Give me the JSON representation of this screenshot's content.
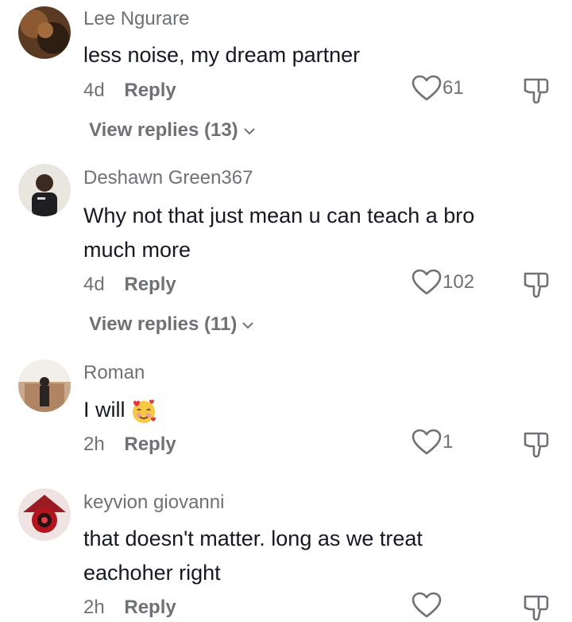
{
  "comments": [
    {
      "username": "Lee Ngurare",
      "text": "less noise, my dream partner",
      "time": "4d",
      "reply": "Reply",
      "likes": "61",
      "view_replies": "View replies (13)"
    },
    {
      "username": "Deshawn Green367",
      "text": "Why not that just mean u can teach a bro much more",
      "time": "4d",
      "reply": "Reply",
      "likes": "102",
      "view_replies": "View replies (11)"
    },
    {
      "username": "Roman",
      "text": "I will",
      "time": "2h",
      "reply": "Reply",
      "likes": "1"
    },
    {
      "username": "keyvion giovanni",
      "text": "that doesn't matter. long as we treat eachoher right",
      "time": "2h",
      "reply": "Reply",
      "likes": ""
    }
  ],
  "icons": {
    "like": "heart-outline-icon",
    "dislike": "thumbs-down-icon",
    "emoji": "smiling-face-with-hearts-emoji",
    "chevron": "chevron-down-icon"
  },
  "colors": {
    "primary_text": "#161823",
    "secondary_text": "#6f7177"
  }
}
